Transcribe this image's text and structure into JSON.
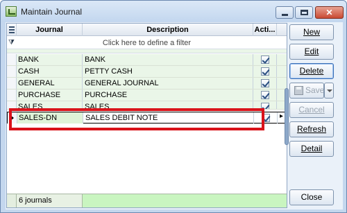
{
  "window": {
    "title": "Maintain Journal"
  },
  "grid": {
    "columns": [
      "Journal",
      "Description",
      "Acti..."
    ],
    "filter_placeholder": "Click here to define a filter",
    "rows": [
      {
        "journal": "BANK",
        "description": "BANK",
        "active": true
      },
      {
        "journal": "CASH",
        "description": "PETTY CASH",
        "active": true
      },
      {
        "journal": "GENERAL",
        "description": "GENERAL JOURNAL",
        "active": true
      },
      {
        "journal": "PURCHASE",
        "description": "PURCHASE",
        "active": true
      },
      {
        "journal": "SALES",
        "description": "SALES",
        "active": true
      },
      {
        "journal": "SALES-DN",
        "description": "SALES DEBIT NOTE",
        "active": true,
        "selected": true
      }
    ],
    "footer_count": "6 journals"
  },
  "buttons": {
    "new": "New",
    "edit": "Edit",
    "delete": "Delete",
    "save": "Save",
    "cancel": "Cancel",
    "refresh": "Refresh",
    "detail": "Detail",
    "close": "Close"
  },
  "colors": {
    "highlight": "#d9121a",
    "row_bg": "#eaf6e8",
    "footer_bg": "#c9f5c0"
  }
}
